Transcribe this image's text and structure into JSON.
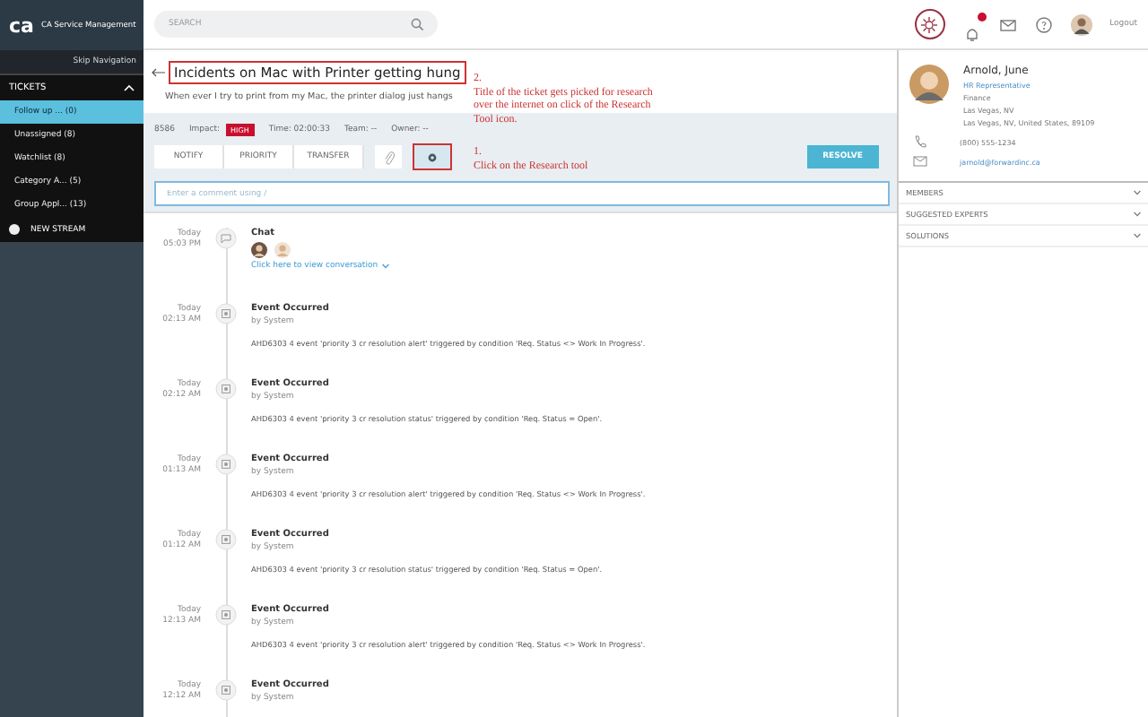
{
  "app": {
    "name": "CA Service Management",
    "logo": "ca"
  },
  "search": {
    "placeholder": "SEARCH"
  },
  "header": {
    "logout": "Logout"
  },
  "sidebar": {
    "skip_link": "Skip Navigation",
    "section": "TICKETS",
    "expanded": true,
    "items": [
      {
        "label": "Follow up ... (0)",
        "selected": true
      },
      {
        "label": "Unassigned (8)",
        "selected": false
      },
      {
        "label": "Watchlist (8)",
        "selected": false
      },
      {
        "label": "Category A... (5)",
        "selected": false
      },
      {
        "label": "Group Appl... (13)",
        "selected": false
      }
    ],
    "new_stream": "NEW STREAM"
  },
  "ticket": {
    "title": "Incidents on Mac with Printer getting hung",
    "description": "When ever I try to print from my Mac, the printer dialog just hangs",
    "id": "8586",
    "impact_label": "Impact:",
    "impact": "HIGH",
    "time": "Time: 02:00:33",
    "team": "Team: --",
    "owner": "Owner: --",
    "actions": [
      "NOTIFY",
      "PRIORITY",
      "TRANSFER"
    ],
    "resolve": "RESOLVE",
    "comment_placeholder": "Enter a comment using /"
  },
  "annotations": [
    {
      "number": "2.",
      "text": "Title of the ticket gets picked for research over the internet on click of the Research Tool icon."
    },
    {
      "number": "1.",
      "text": "Click on the Research tool"
    }
  ],
  "timeline": [
    {
      "kind": "chat",
      "day": "Today",
      "time": "05:03 PM",
      "title": "Chat",
      "link": "Click here to view conversation"
    },
    {
      "kind": "event",
      "day": "Today",
      "time": "02:13 AM",
      "title": "Event Occurred",
      "by": "by System",
      "text": "AHD6303 4 event 'priority 3 cr resolution alert' triggered by condition 'Req. Status <> Work In Progress'."
    },
    {
      "kind": "event",
      "day": "Today",
      "time": "02:12 AM",
      "title": "Event Occurred",
      "by": "by System",
      "text": "AHD6303 4 event 'priority 3 cr resolution status' triggered by condition 'Req. Status = Open'."
    },
    {
      "kind": "event",
      "day": "Today",
      "time": "01:13 AM",
      "title": "Event Occurred",
      "by": "by System",
      "text": "AHD6303 4 event 'priority 3 cr resolution alert' triggered by condition 'Req. Status <> Work In Progress'."
    },
    {
      "kind": "event",
      "day": "Today",
      "time": "01:12 AM",
      "title": "Event Occurred",
      "by": "by System",
      "text": "AHD6303 4 event 'priority 3 cr resolution status' triggered by condition 'Req. Status = Open'."
    },
    {
      "kind": "event",
      "day": "Today",
      "time": "12:13 AM",
      "title": "Event Occurred",
      "by": "by System",
      "text": "AHD6303 4 event 'priority 3 cr resolution alert' triggered by condition 'Req. Status <> Work In Progress'."
    },
    {
      "kind": "event",
      "day": "Today",
      "time": "12:12 AM",
      "title": "Event Occurred",
      "by": "by System"
    }
  ],
  "contact": {
    "name": "Arnold, June",
    "role": "HR Representative",
    "department": "Finance",
    "city": "Las Vegas, NV",
    "address": "Las Vegas, NV, United States, 89109",
    "phone": "(800) 555-1234",
    "email": "jarnold@forwardinc.ca"
  },
  "sections": [
    {
      "label": "MEMBERS",
      "expanded": false
    },
    {
      "label": "SUGGESTED EXPERTS",
      "expanded": false
    },
    {
      "label": "SOLUTIONS",
      "expanded": false
    }
  ]
}
